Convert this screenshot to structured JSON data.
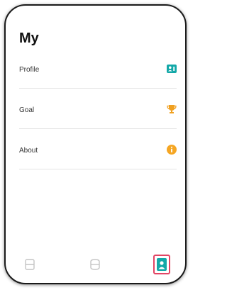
{
  "page": {
    "title": "My"
  },
  "menu": {
    "items": [
      {
        "label": "Profile",
        "icon": "profile-card-icon",
        "icon_color": "#13a8a8"
      },
      {
        "label": "Goal",
        "icon": "trophy-icon",
        "icon_color": "#f0a020"
      },
      {
        "label": "About",
        "icon": "info-icon",
        "icon_color": "#f5a623"
      }
    ]
  },
  "tabbar": {
    "tabs": [
      {
        "icon": "list-tab-icon",
        "active": false
      },
      {
        "icon": "database-tab-icon",
        "active": false
      },
      {
        "icon": "person-tab-icon",
        "active": true
      }
    ],
    "active_color": "#13a8a8",
    "highlight_color": "#e24565",
    "inactive_color": "#c4c4c4"
  }
}
